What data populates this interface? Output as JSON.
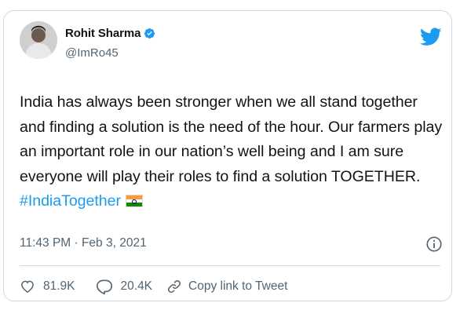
{
  "author": {
    "name": "Rohit Sharma",
    "handle": "@ImRo45",
    "verified": true
  },
  "tweet": {
    "text": "India has always been stronger when we all stand together and finding a solution is the need of the hour. Our farmers play an important role in our nation’s well being and I am sure everyone will play their roles to find a solution TOGETHER.",
    "hashtag": "#IndiaTogether",
    "emoji": "india-flag"
  },
  "meta": {
    "timestamp": "11:43 PM · Feb 3, 2021"
  },
  "actions": {
    "likes": "81.9K",
    "replies": "20.4K",
    "copy_link": "Copy link to Tweet"
  },
  "colors": {
    "accent": "#1d9bf0",
    "text": "#0f1419",
    "muted": "#536471",
    "border": "#cfd9de"
  },
  "icons": [
    "verified-badge-icon",
    "twitter-bird-icon",
    "info-icon",
    "heart-icon",
    "reply-icon",
    "link-icon"
  ]
}
